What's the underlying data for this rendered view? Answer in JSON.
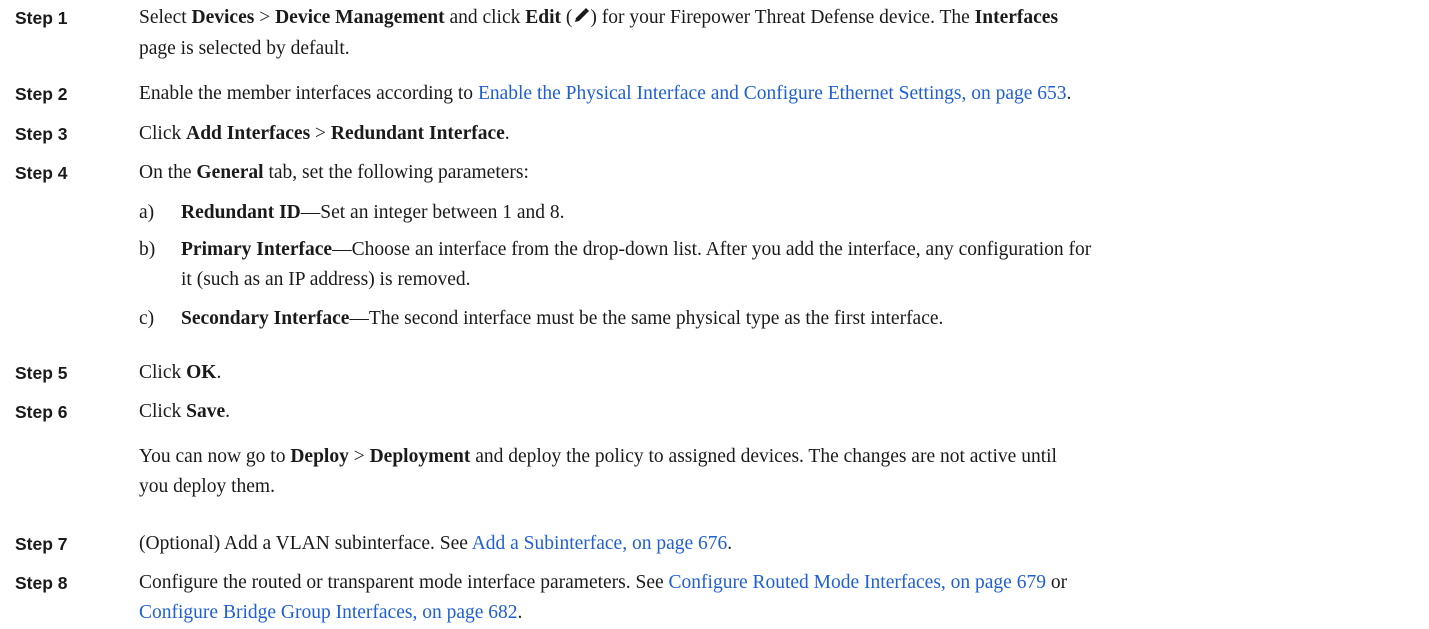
{
  "steps": [
    {
      "label": "Step 1",
      "s1_a": "Select ",
      "s1_b": "Devices",
      "s1_c": " > ",
      "s1_d": "Device Management",
      "s1_e": " and click ",
      "s1_f": "Edit",
      "s1_g": " (",
      "s1_h": ") for your Firepower Threat Defense device. The ",
      "s1_i": "Interfaces",
      "s1_j": "page is selected by default."
    },
    {
      "label": "Step 2",
      "s2_a": "Enable the member interfaces according to ",
      "s2_link": "Enable the Physical Interface and Configure Ethernet Settings, on page 653",
      "s2_b": "."
    },
    {
      "label": "Step 3",
      "s3_a": "Click ",
      "s3_b": "Add Interfaces",
      "s3_c": " > ",
      "s3_d": "Redundant Interface",
      "s3_e": "."
    },
    {
      "label": "Step 4",
      "s4_a": "On the ",
      "s4_b": "General",
      "s4_c": " tab, set the following parameters:",
      "items": [
        {
          "marker": "a)",
          "bold": "Redundant ID",
          "text": "—Set an integer between 1 and 8."
        },
        {
          "marker": "b)",
          "bold": "Primary Interface",
          "text": "—Choose an interface from the drop-down list. After you add the interface, any configuration for",
          "text2": "it (such as an IP address) is removed."
        },
        {
          "marker": "c)",
          "bold": "Secondary Interface",
          "text": "—The second interface must be the same physical type as the first interface."
        }
      ]
    },
    {
      "label": "Step 5",
      "s5_a": "Click ",
      "s5_b": "OK",
      "s5_c": "."
    },
    {
      "label": "Step 6",
      "s6_a": "Click ",
      "s6_b": "Save",
      "s6_c": ".",
      "p_a": "You can now go to ",
      "p_b": "Deploy",
      "p_c": " > ",
      "p_d": "Deployment",
      "p_e": " and deploy the policy to assigned devices. The changes are not active until",
      "p_f": "you deploy them."
    },
    {
      "label": "Step 7",
      "s7_a": "(Optional) Add a VLAN subinterface. See ",
      "s7_link": "Add a Subinterface, on page 676",
      "s7_b": "."
    },
    {
      "label": "Step 8",
      "s8_a": "Configure the routed or transparent mode interface parameters. See ",
      "s8_link1": "Configure Routed Mode Interfaces, on page 679",
      "s8_b": " or",
      "s8_link2": "Configure Bridge Group Interfaces, on page 682",
      "s8_c": "."
    }
  ],
  "icons": {
    "edit": "pencil-icon"
  },
  "colors": {
    "link": "#1f5fd6",
    "text": "#1a1a1a"
  }
}
